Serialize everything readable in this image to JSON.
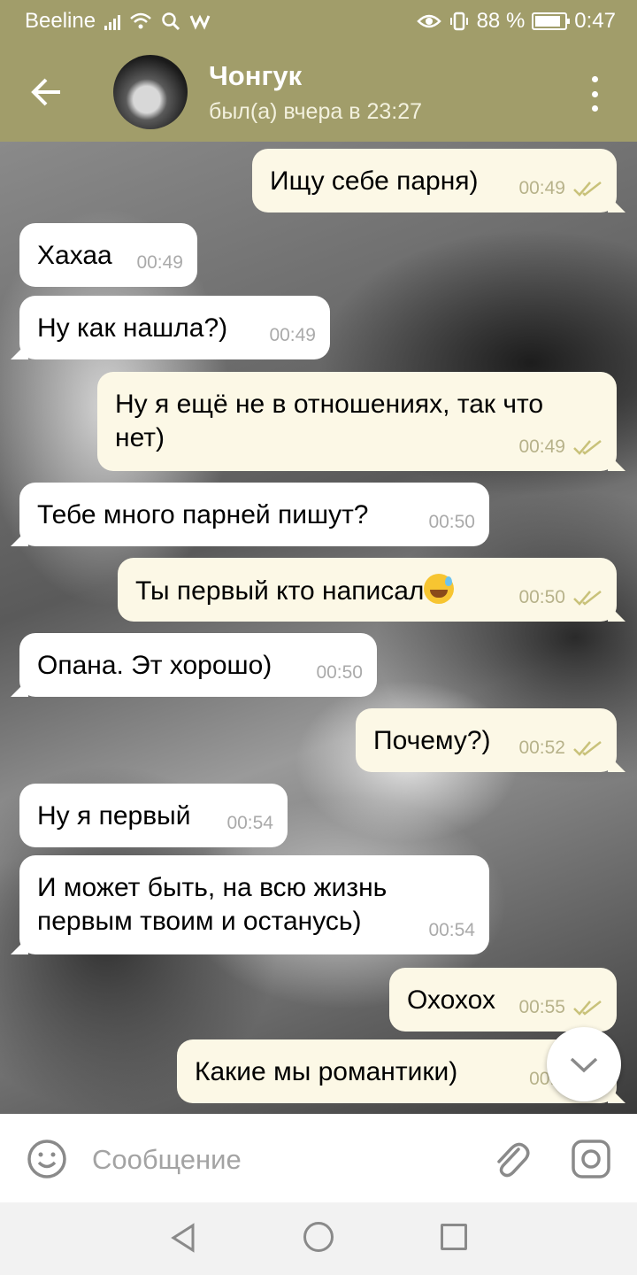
{
  "status_bar": {
    "carrier": "Beeline",
    "battery_text": "88 %",
    "battery_level": 0.88,
    "time": "0:47"
  },
  "header": {
    "title": "Чонгук",
    "subtitle": "был(а) вчера в 23:27"
  },
  "messages": [
    {
      "dir": "out",
      "text": "Ищу себе парня)",
      "time": "00:49"
    },
    {
      "dir": "in",
      "text": "Хахаа",
      "time": "00:49"
    },
    {
      "dir": "in",
      "text": "Ну как нашла?)",
      "time": "00:49"
    },
    {
      "dir": "out",
      "text": "Ну я ещё не в отношениях, так что\nнет)",
      "time": "00:49"
    },
    {
      "dir": "in",
      "text": "Тебе много парней пишут?",
      "time": "00:50"
    },
    {
      "dir": "out",
      "text": "Ты первый кто написал",
      "emoji": "sweat-smile-emoji",
      "time": "00:50"
    },
    {
      "dir": "in",
      "text": "Опана. Эт хорошо)",
      "time": "00:50"
    },
    {
      "dir": "out",
      "text": "Почему?)",
      "time": "00:52"
    },
    {
      "dir": "in",
      "text": "Ну я первый",
      "time": "00:54"
    },
    {
      "dir": "in",
      "text": "И может быть, на всю жизнь\nпервым твоим и останусь)",
      "time": "00:54"
    },
    {
      "dir": "out",
      "text": "Охохох",
      "time": "00:55"
    },
    {
      "dir": "out",
      "text": "Какие мы романтики)",
      "time": "00:5"
    }
  ],
  "input": {
    "placeholder": "Сообщение"
  },
  "colors": {
    "header_bg": "#a19d6a",
    "incoming_bubble": "#ffffff",
    "outgoing_bubble": "#fcf8e6",
    "read_check": "#c9c27a"
  },
  "icons": {
    "back": "arrow-left-icon",
    "menu": "kebab-menu-icon",
    "emoji": "smile-icon",
    "attach": "paperclip-icon",
    "camera": "camera-icon",
    "scroll": "chevron-down-icon"
  }
}
